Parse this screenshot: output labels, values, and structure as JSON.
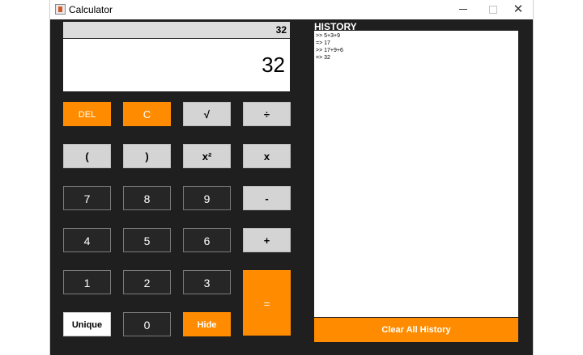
{
  "window": {
    "title": "Calculator",
    "controls": {
      "minimize": "—",
      "maximize": "☐",
      "close": "✕"
    }
  },
  "display": {
    "expression": "32",
    "result": "32"
  },
  "buttons": {
    "del": "DEL",
    "clear": "C",
    "sqrt": "√",
    "divide": "÷",
    "open_paren": "(",
    "close_paren": ")",
    "square": "x²",
    "multiply": "x",
    "seven": "7",
    "eight": "8",
    "nine": "9",
    "minus": "-",
    "four": "4",
    "five": "5",
    "six": "6",
    "plus": "+",
    "one": "1",
    "two": "2",
    "three": "3",
    "equals": "=",
    "unique": "Unique",
    "zero": "0",
    "hide": "Hide"
  },
  "history": {
    "label": "HISTORY",
    "lines": [
      ">> 5+3+9",
      "=> 17",
      ">> 17+9+6",
      "=> 32"
    ],
    "clear_label": "Clear All History"
  },
  "colors": {
    "accent": "#ff8c00",
    "background": "#1f1f1f",
    "operator_button": "#d4d4d4",
    "digit_button": "#262626"
  }
}
